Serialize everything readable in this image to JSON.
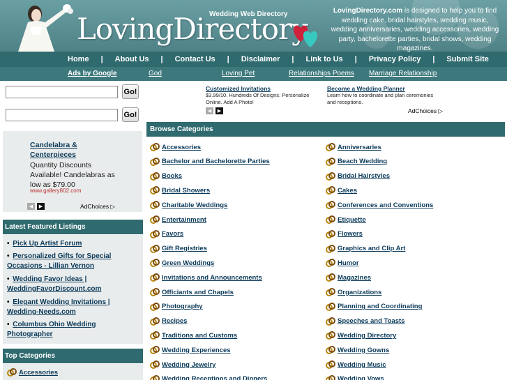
{
  "header": {
    "tagline": "Wedding Web Directory",
    "logo": "LovingDirectory",
    "desc_brand": "LovingDirectory.com",
    "desc_text": " is designed to help you to find wedding cake, bridal hairstyles, wedding music, wedding anniversaries, wedding accessories, wedding party, bachelorette parties, bridal shows, wedding magazines."
  },
  "nav": {
    "items": [
      "Home",
      "About Us",
      "Contact Us",
      "Disclaimer",
      "Link to Us",
      "Privacy Policy",
      "Submit Site"
    ],
    "sep": "|"
  },
  "adrow": {
    "ads_by_google": "Ads by Google",
    "links": [
      "God",
      "Loving Pet",
      "Relationships Poems",
      "Marriage Relationship"
    ]
  },
  "search": {
    "go_label": "Go!",
    "value1": "",
    "value2": ""
  },
  "left_ad": {
    "title": "Candelabra & Centerpieces",
    "body": "Quantity Discounts Available! Candelabras as low as $79.00",
    "url": "www.gallery802.com",
    "adchoices": "AdChoices"
  },
  "right_ads": [
    {
      "title": "Customized Invitations",
      "body": "$3.99/10. Hundreds Of Designs. Personalize Online. Add A Photo!"
    },
    {
      "title": "Become a Wedding Planner",
      "body": "Learn how to coordinate and plan ceremonies and receptions."
    }
  ],
  "right_adchoices": "AdChoices",
  "featured": {
    "heading": "Latest Featured Listings",
    "items": [
      "Pick Up Artist Forum",
      "Personalized Gifts for Special Occasions - Lillian Vernon",
      "Wedding Favor Ideas | WeddingFavorDiscount.com",
      "Elegant Wedding Invitations | Wedding-Needs.com",
      "Columbus Ohio Wedding Photographer"
    ],
    "bullet": "•"
  },
  "top_categories": {
    "heading": "Top Categories",
    "first_item": "Accessories"
  },
  "browse": {
    "heading": "Browse Categories",
    "left": [
      "Accessories",
      "Bachelor and Bachelorette Parties",
      "Books",
      "Bridal Showers",
      "Charitable Weddings",
      "Entertainment",
      "Favors",
      "Gift Registries",
      "Green Weddings",
      "Invitations and Announcements",
      "Officiants and Chapels",
      "Photography",
      "Recipes",
      "Traditions and Customs",
      "Wedding Experiences",
      "Wedding Jewelry",
      "Wedding Receptions and Dinners"
    ],
    "right": [
      "Anniversaries",
      "Beach Wedding",
      "Bridal Hairstyles",
      "Cakes",
      "Conferences and Conventions",
      "Etiquette",
      "Flowers",
      "Graphics and Clip Art",
      "Humor",
      "Magazines",
      "Organizations",
      "Planning and Coordinating",
      "Speeches and Toasts",
      "Wedding Directory",
      "Wedding Gowns",
      "Wedding Music",
      "Wedding Vows"
    ]
  },
  "colors": {
    "header_teal": "#5a8e92",
    "nav_teal": "#2f6a6f",
    "link_navy": "#0b3a5a",
    "panel_grey": "#e9ecec"
  }
}
